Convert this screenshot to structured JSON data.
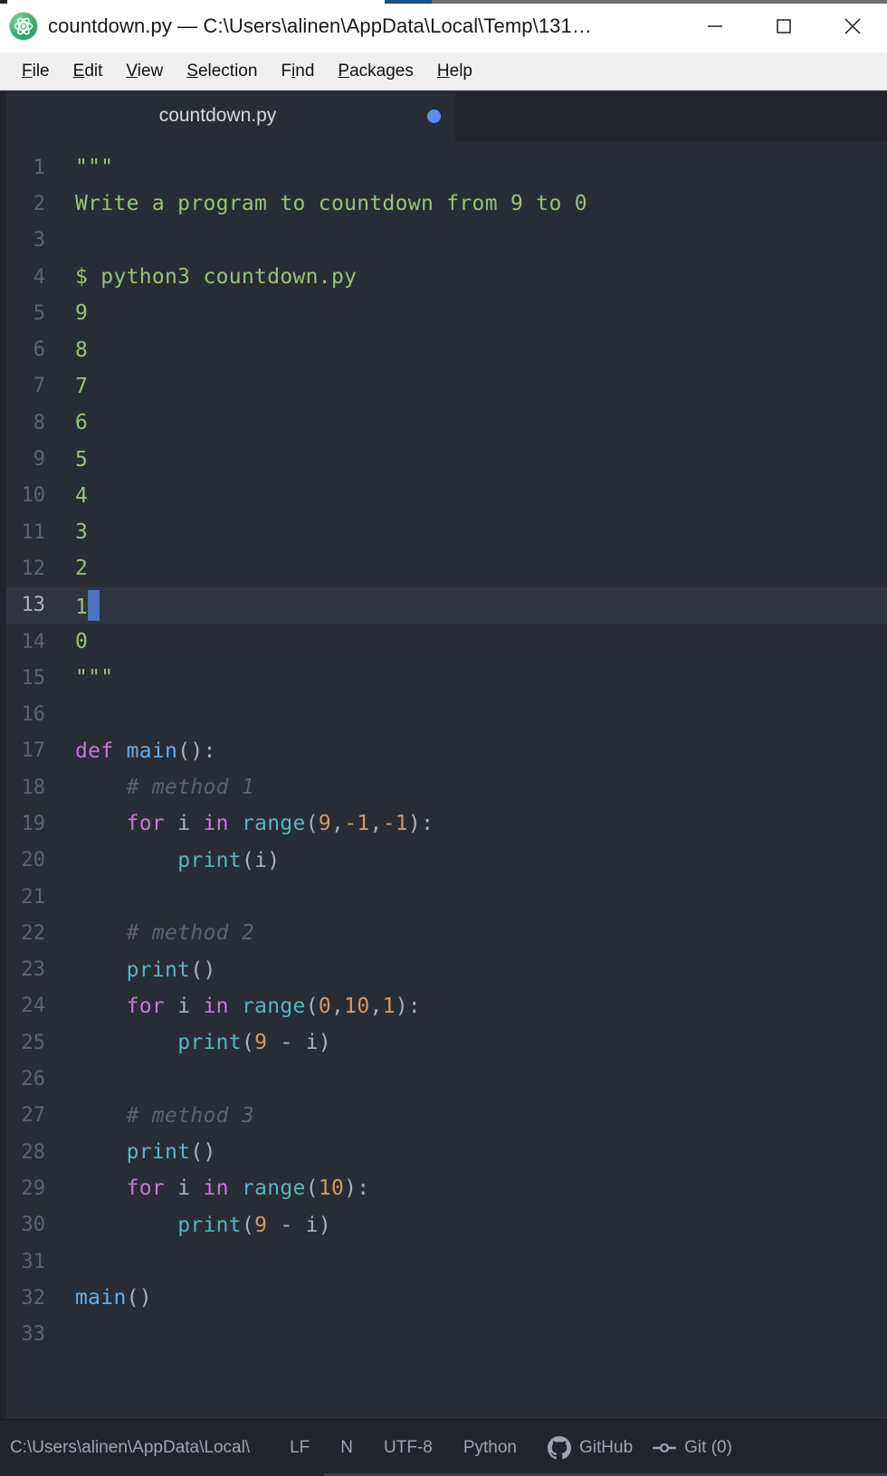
{
  "window": {
    "title": "countdown.py — C:\\Users\\alinen\\AppData\\Local\\Temp\\131…",
    "app_icon": "atom-icon",
    "controls": {
      "minimize": "minimize-icon",
      "maximize": "maximize-icon",
      "close": "close-icon"
    }
  },
  "menubar": {
    "items": [
      {
        "label": "File",
        "pre": "",
        "mn": "F",
        "post": "ile"
      },
      {
        "label": "Edit",
        "pre": "",
        "mn": "E",
        "post": "dit"
      },
      {
        "label": "View",
        "pre": "",
        "mn": "V",
        "post": "iew"
      },
      {
        "label": "Selection",
        "pre": "",
        "mn": "S",
        "post": "election"
      },
      {
        "label": "Find",
        "pre": "F",
        "mn": "i",
        "post": "nd"
      },
      {
        "label": "Packages",
        "pre": "",
        "mn": "P",
        "post": "ackages"
      },
      {
        "label": "Help",
        "pre": "",
        "mn": "H",
        "post": "elp"
      }
    ]
  },
  "tabs": [
    {
      "label": "countdown.py",
      "modified": true,
      "active": true,
      "dot_color": "#5b8ff0"
    }
  ],
  "editor": {
    "active_line": 13,
    "cursor_column": 2,
    "total_lines": 33,
    "lines": [
      {
        "n": 1,
        "tokens": [
          {
            "t": "\"\"\"",
            "c": "s-str"
          }
        ]
      },
      {
        "n": 2,
        "tokens": [
          {
            "t": "Write a program to countdown from 9 to 0",
            "c": "s-str"
          }
        ]
      },
      {
        "n": 3,
        "tokens": []
      },
      {
        "n": 4,
        "tokens": [
          {
            "t": "$ python3 countdown.py",
            "c": "s-str"
          }
        ]
      },
      {
        "n": 5,
        "tokens": [
          {
            "t": "9",
            "c": "s-str"
          }
        ]
      },
      {
        "n": 6,
        "tokens": [
          {
            "t": "8",
            "c": "s-str"
          }
        ]
      },
      {
        "n": 7,
        "tokens": [
          {
            "t": "7",
            "c": "s-str"
          }
        ]
      },
      {
        "n": 8,
        "tokens": [
          {
            "t": "6",
            "c": "s-str"
          }
        ]
      },
      {
        "n": 9,
        "tokens": [
          {
            "t": "5",
            "c": "s-str"
          }
        ]
      },
      {
        "n": 10,
        "tokens": [
          {
            "t": "4",
            "c": "s-str"
          }
        ]
      },
      {
        "n": 11,
        "tokens": [
          {
            "t": "3",
            "c": "s-str"
          }
        ]
      },
      {
        "n": 12,
        "tokens": [
          {
            "t": "2",
            "c": "s-str"
          }
        ]
      },
      {
        "n": 13,
        "tokens": [
          {
            "t": "1",
            "c": "s-str"
          },
          {
            "t": "",
            "c": "cursor"
          }
        ]
      },
      {
        "n": 14,
        "tokens": [
          {
            "t": "0",
            "c": "s-str"
          }
        ]
      },
      {
        "n": 15,
        "tokens": [
          {
            "t": "\"\"\"",
            "c": "s-str"
          }
        ]
      },
      {
        "n": 16,
        "tokens": []
      },
      {
        "n": 17,
        "tokens": [
          {
            "t": "def ",
            "c": "s-kw"
          },
          {
            "t": "main",
            "c": "s-fn"
          },
          {
            "t": "():",
            "c": "s-op"
          }
        ]
      },
      {
        "n": 18,
        "tokens": [
          {
            "t": "    # method 1",
            "c": "s-com"
          }
        ]
      },
      {
        "n": 19,
        "tokens": [
          {
            "t": "    ",
            "c": "s-plain"
          },
          {
            "t": "for",
            "c": "s-kw"
          },
          {
            "t": " i ",
            "c": "s-plain"
          },
          {
            "t": "in",
            "c": "s-kw"
          },
          {
            "t": " ",
            "c": "s-plain"
          },
          {
            "t": "range",
            "c": "s-builtin"
          },
          {
            "t": "(",
            "c": "s-op"
          },
          {
            "t": "9",
            "c": "s-num"
          },
          {
            "t": ",",
            "c": "s-op"
          },
          {
            "t": "-1",
            "c": "s-num"
          },
          {
            "t": ",",
            "c": "s-op"
          },
          {
            "t": "-1",
            "c": "s-num"
          },
          {
            "t": "):",
            "c": "s-op"
          }
        ]
      },
      {
        "n": 20,
        "tokens": [
          {
            "t": "        ",
            "c": "s-plain"
          },
          {
            "t": "print",
            "c": "s-builtin"
          },
          {
            "t": "(i)",
            "c": "s-op"
          }
        ]
      },
      {
        "n": 21,
        "tokens": []
      },
      {
        "n": 22,
        "tokens": [
          {
            "t": "    # method 2",
            "c": "s-com"
          }
        ]
      },
      {
        "n": 23,
        "tokens": [
          {
            "t": "    ",
            "c": "s-plain"
          },
          {
            "t": "print",
            "c": "s-builtin"
          },
          {
            "t": "()",
            "c": "s-op"
          }
        ]
      },
      {
        "n": 24,
        "tokens": [
          {
            "t": "    ",
            "c": "s-plain"
          },
          {
            "t": "for",
            "c": "s-kw"
          },
          {
            "t": " i ",
            "c": "s-plain"
          },
          {
            "t": "in",
            "c": "s-kw"
          },
          {
            "t": " ",
            "c": "s-plain"
          },
          {
            "t": "range",
            "c": "s-builtin"
          },
          {
            "t": "(",
            "c": "s-op"
          },
          {
            "t": "0",
            "c": "s-num"
          },
          {
            "t": ",",
            "c": "s-op"
          },
          {
            "t": "10",
            "c": "s-num"
          },
          {
            "t": ",",
            "c": "s-op"
          },
          {
            "t": "1",
            "c": "s-num"
          },
          {
            "t": "):",
            "c": "s-op"
          }
        ]
      },
      {
        "n": 25,
        "tokens": [
          {
            "t": "        ",
            "c": "s-plain"
          },
          {
            "t": "print",
            "c": "s-builtin"
          },
          {
            "t": "(",
            "c": "s-op"
          },
          {
            "t": "9",
            "c": "s-num"
          },
          {
            "t": " - i)",
            "c": "s-op"
          }
        ]
      },
      {
        "n": 26,
        "tokens": []
      },
      {
        "n": 27,
        "tokens": [
          {
            "t": "    # method 3",
            "c": "s-com"
          }
        ]
      },
      {
        "n": 28,
        "tokens": [
          {
            "t": "    ",
            "c": "s-plain"
          },
          {
            "t": "print",
            "c": "s-builtin"
          },
          {
            "t": "()",
            "c": "s-op"
          }
        ]
      },
      {
        "n": 29,
        "tokens": [
          {
            "t": "    ",
            "c": "s-plain"
          },
          {
            "t": "for",
            "c": "s-kw"
          },
          {
            "t": " i ",
            "c": "s-plain"
          },
          {
            "t": "in",
            "c": "s-kw"
          },
          {
            "t": " ",
            "c": "s-plain"
          },
          {
            "t": "range",
            "c": "s-builtin"
          },
          {
            "t": "(",
            "c": "s-op"
          },
          {
            "t": "10",
            "c": "s-num"
          },
          {
            "t": "):",
            "c": "s-op"
          }
        ]
      },
      {
        "n": 30,
        "tokens": [
          {
            "t": "        ",
            "c": "s-plain"
          },
          {
            "t": "print",
            "c": "s-builtin"
          },
          {
            "t": "(",
            "c": "s-op"
          },
          {
            "t": "9",
            "c": "s-num"
          },
          {
            "t": " - i)",
            "c": "s-op"
          }
        ]
      },
      {
        "n": 31,
        "tokens": []
      },
      {
        "n": 32,
        "tokens": [
          {
            "t": "main",
            "c": "s-fn"
          },
          {
            "t": "()",
            "c": "s-op"
          }
        ]
      },
      {
        "n": 33,
        "tokens": []
      }
    ]
  },
  "statusbar": {
    "path": "C:\\Users\\alinen\\AppData\\Local\\",
    "line_ending": "LF",
    "indent": "N",
    "encoding": "UTF-8",
    "grammar": "Python",
    "github": {
      "label": "GitHub",
      "icon": "github-icon"
    },
    "git": {
      "label": "Git (0)",
      "icon": "git-branch-icon"
    }
  },
  "colors": {
    "accent": "#568af2",
    "editor_bg": "#282c34",
    "chrome_bg": "#21252b",
    "string": "#98c379",
    "keyword": "#c678dd",
    "function": "#61afef",
    "builtin": "#56b6c2",
    "number": "#d19a66",
    "comment": "#5c6370",
    "cursor": "#4f72bd"
  }
}
